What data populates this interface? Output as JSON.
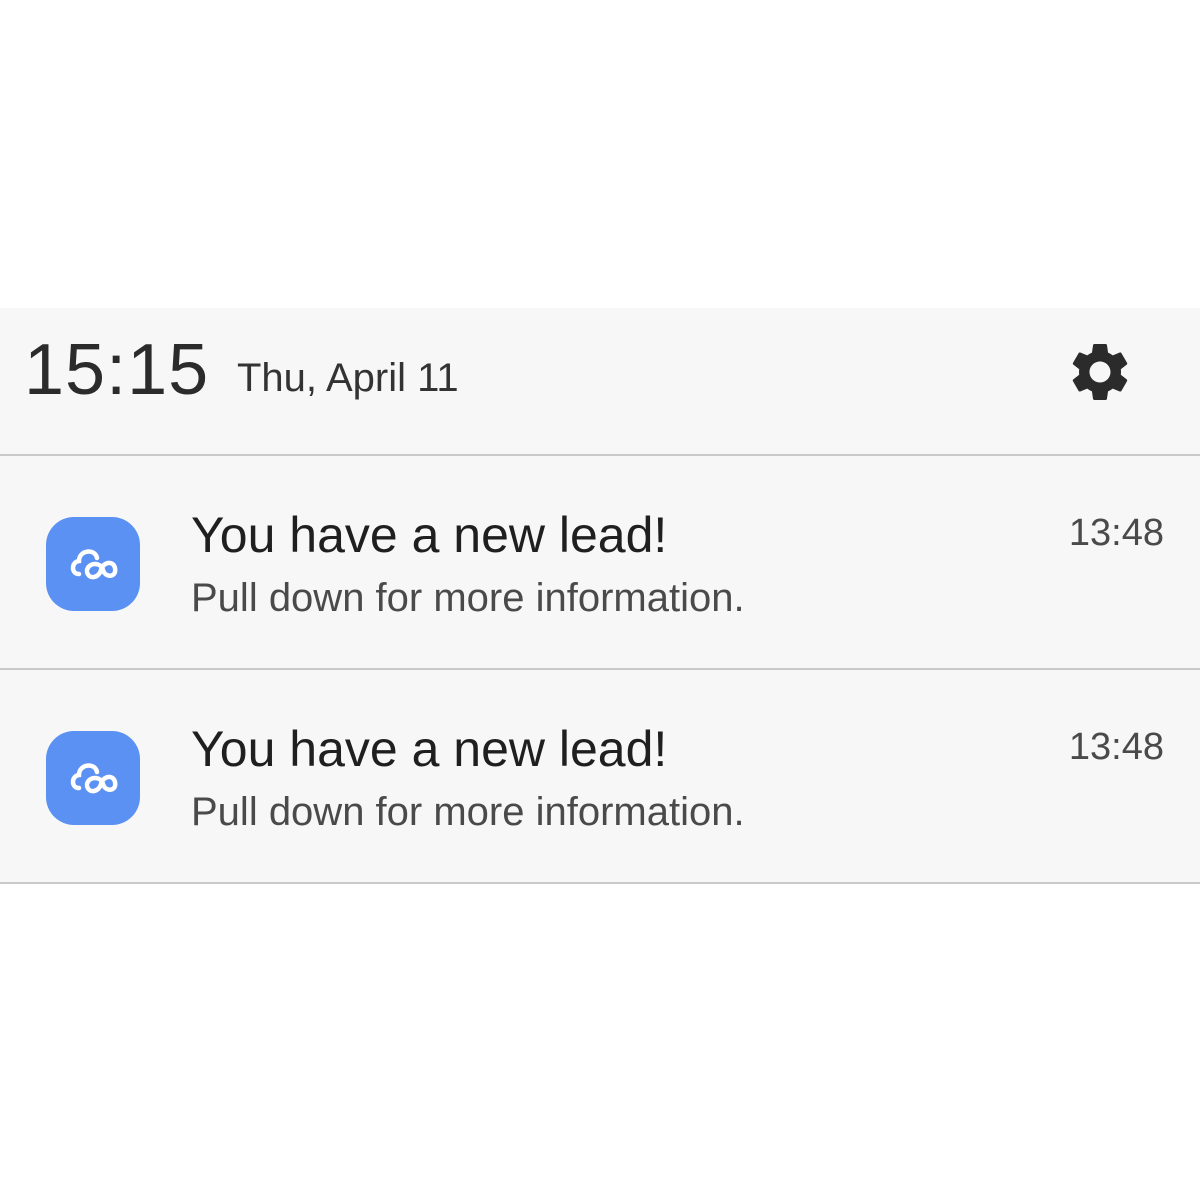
{
  "header": {
    "clock": "15:15",
    "date": "Thu, April 11",
    "settings_icon": "gear-icon"
  },
  "notifications": [
    {
      "icon": "cloud-link-icon",
      "title": "You have a new lead!",
      "body": "Pull down for more information.",
      "time": "13:48"
    },
    {
      "icon": "cloud-link-icon",
      "title": "You have a new lead!",
      "body": "Pull down for more information.",
      "time": "13:48"
    }
  ],
  "colors": {
    "app_icon": "#5b91f2",
    "shade_background": "#f7f7f7",
    "divider": "#c9c9c9"
  }
}
